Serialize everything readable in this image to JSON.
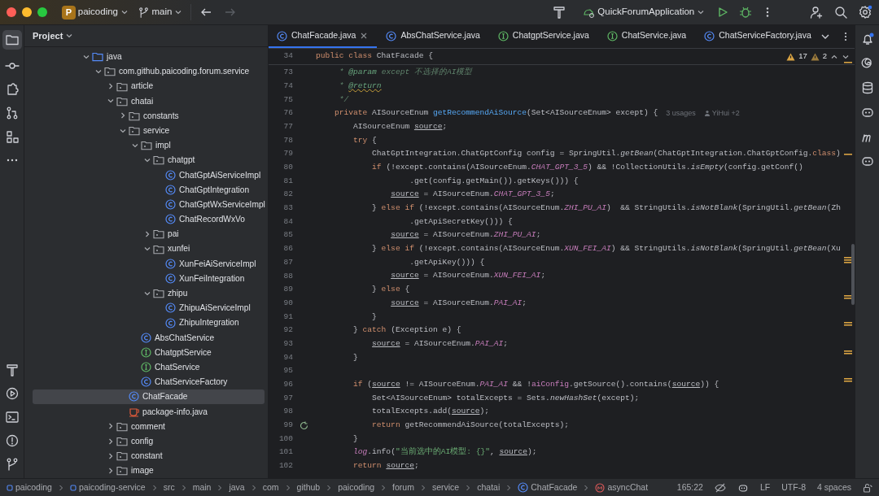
{
  "titlebar": {
    "project_badge": "P",
    "project": "paicoding",
    "branch": "main",
    "run_config": "QuickForumApplication"
  },
  "project_panel": {
    "title": "Project",
    "tree": [
      {
        "label": "java",
        "kind": "folder",
        "expanded": true,
        "selected": false,
        "children": [
          {
            "label": "com.github.paicoding.forum.service",
            "kind": "package",
            "expanded": true,
            "selected": false,
            "children": [
              {
                "label": "article",
                "kind": "package",
                "expanded": false,
                "selected": false
              },
              {
                "label": "chatai",
                "kind": "package",
                "expanded": true,
                "selected": false,
                "children": [
                  {
                    "label": "constants",
                    "kind": "package",
                    "expanded": false,
                    "selected": false
                  },
                  {
                    "label": "service",
                    "kind": "package",
                    "expanded": true,
                    "selected": false,
                    "children": [
                      {
                        "label": "impl",
                        "kind": "package",
                        "expanded": true,
                        "selected": false,
                        "children": [
                          {
                            "label": "chatgpt",
                            "kind": "package",
                            "expanded": true,
                            "selected": false,
                            "children": [
                              {
                                "label": "ChatGptAiServiceImpl",
                                "kind": "class",
                                "selected": false
                              },
                              {
                                "label": "ChatGptIntegration",
                                "kind": "class",
                                "selected": false
                              },
                              {
                                "label": "ChatGptWxServiceImpl",
                                "kind": "class",
                                "selected": false
                              },
                              {
                                "label": "ChatRecordWxVo",
                                "kind": "class",
                                "selected": false
                              }
                            ]
                          },
                          {
                            "label": "pai",
                            "kind": "package",
                            "expanded": false,
                            "selected": false
                          },
                          {
                            "label": "xunfei",
                            "kind": "package",
                            "expanded": true,
                            "selected": false,
                            "children": [
                              {
                                "label": "XunFeiAiServiceImpl",
                                "kind": "class",
                                "selected": false
                              },
                              {
                                "label": "XunFeiIntegration",
                                "kind": "class",
                                "selected": false
                              }
                            ]
                          },
                          {
                            "label": "zhipu",
                            "kind": "package",
                            "expanded": true,
                            "selected": false,
                            "children": [
                              {
                                "label": "ZhipuAiServiceImpl",
                                "kind": "class",
                                "selected": false
                              },
                              {
                                "label": "ZhipuIntegration",
                                "kind": "class",
                                "selected": false
                              }
                            ]
                          }
                        ]
                      },
                      {
                        "label": "AbsChatService",
                        "kind": "class",
                        "selected": false
                      },
                      {
                        "label": "ChatgptService",
                        "kind": "interface",
                        "selected": false
                      },
                      {
                        "label": "ChatService",
                        "kind": "interface",
                        "selected": false
                      },
                      {
                        "label": "ChatServiceFactory",
                        "kind": "class",
                        "selected": false
                      }
                    ]
                  },
                  {
                    "label": "ChatFacade",
                    "kind": "class",
                    "selected": true
                  },
                  {
                    "label": "package-info.java",
                    "kind": "file",
                    "selected": false
                  }
                ]
              },
              {
                "label": "comment",
                "kind": "package",
                "expanded": false,
                "selected": false
              },
              {
                "label": "config",
                "kind": "package",
                "expanded": false,
                "selected": false
              },
              {
                "label": "constant",
                "kind": "package",
                "expanded": false,
                "selected": false
              },
              {
                "label": "image",
                "kind": "package",
                "expanded": false,
                "selected": false
              }
            ]
          }
        ]
      }
    ]
  },
  "tabs": [
    {
      "label": "ChatFacade.java",
      "kind": "class",
      "selected": true
    },
    {
      "label": "AbsChatService.java",
      "kind": "class",
      "selected": false
    },
    {
      "label": "ChatgptService.java",
      "kind": "interface",
      "selected": false
    },
    {
      "label": "ChatService.java",
      "kind": "interface",
      "selected": false
    },
    {
      "label": "ChatServiceFactory.java",
      "kind": "class",
      "selected": false
    }
  ],
  "inspections": {
    "warnings": "17",
    "weak_warnings": "2"
  },
  "sticky_line": {
    "number": "34",
    "tokens": [
      {
        "text": "public class ",
        "kind": "keyword"
      },
      {
        "text": "ChatFacade {",
        "kind": "plain"
      }
    ]
  },
  "code_lines": [
    {
      "number": "73",
      "tokens": [
        {
          "text": "     * ",
          "kind": "comment"
        },
        {
          "text": "@param",
          "kind": "doctag"
        },
        {
          "text": " except 不选择的AI模型",
          "kind": "comment"
        }
      ]
    },
    {
      "number": "74",
      "tokens": [
        {
          "text": "     * ",
          "kind": "comment"
        },
        {
          "text": "@return",
          "kind": "doctag-warn"
        }
      ]
    },
    {
      "number": "75",
      "tokens": [
        {
          "text": "     */",
          "kind": "comment"
        }
      ]
    },
    {
      "number": "76",
      "tokens": [
        {
          "text": "    private ",
          "kind": "keyword"
        },
        {
          "text": "AISourceEnum ",
          "kind": "plain"
        },
        {
          "text": "getRecommendAiSource",
          "kind": "declaration"
        },
        {
          "text": "(Set<AISourceEnum> except) {",
          "kind": "plain"
        }
      ],
      "hints": [
        "3 usages",
        "YiHui +2"
      ]
    },
    {
      "number": "77",
      "tokens": [
        {
          "text": "        AISourceEnum ",
          "kind": "plain"
        },
        {
          "text": "source",
          "kind": "variable"
        },
        {
          "text": ";",
          "kind": "plain"
        }
      ]
    },
    {
      "number": "78",
      "tokens": [
        {
          "text": "        try",
          "kind": "keyword"
        },
        {
          "text": " {",
          "kind": "plain"
        }
      ]
    },
    {
      "number": "79",
      "tokens": [
        {
          "text": "            ChatGptIntegration.ChatGptConfig config = SpringUtil.",
          "kind": "plain"
        },
        {
          "text": "getBean",
          "kind": "static"
        },
        {
          "text": "(ChatGptIntegration.ChatGptConfig.",
          "kind": "plain"
        },
        {
          "text": "class",
          "kind": "keyword"
        },
        {
          "text": ")",
          "kind": "plain"
        }
      ]
    },
    {
      "number": "80",
      "tokens": [
        {
          "text": "            if",
          "kind": "keyword"
        },
        {
          "text": " (!except.contains(AISourceEnum.",
          "kind": "plain"
        },
        {
          "text": "CHAT_GPT_3_5",
          "kind": "constant"
        },
        {
          "text": ") && !CollectionUtils.",
          "kind": "plain"
        },
        {
          "text": "isEmpty",
          "kind": "static"
        },
        {
          "text": "(config.getConf()",
          "kind": "plain"
        }
      ]
    },
    {
      "number": "81",
      "tokens": [
        {
          "text": "                    .get(config.getMain()).getKeys())) {",
          "kind": "plain"
        }
      ]
    },
    {
      "number": "82",
      "tokens": [
        {
          "text": "                source",
          "kind": "variable"
        },
        {
          "text": " = AISourceEnum.",
          "kind": "plain"
        },
        {
          "text": "CHAT_GPT_3_5",
          "kind": "constant"
        },
        {
          "text": ";",
          "kind": "plain"
        }
      ]
    },
    {
      "number": "83",
      "tokens": [
        {
          "text": "            } ",
          "kind": "plain"
        },
        {
          "text": "else if",
          "kind": "keyword"
        },
        {
          "text": " (!except.contains(AISourceEnum.",
          "kind": "plain"
        },
        {
          "text": "ZHI_PU_AI",
          "kind": "constant"
        },
        {
          "text": ")  && StringUtils.",
          "kind": "plain"
        },
        {
          "text": "isNotBlank",
          "kind": "static"
        },
        {
          "text": "(SpringUtil.",
          "kind": "plain"
        },
        {
          "text": "getBean",
          "kind": "static"
        },
        {
          "text": "(Zh",
          "kind": "plain"
        }
      ]
    },
    {
      "number": "84",
      "tokens": [
        {
          "text": "                    .getApiSecretKey())) {",
          "kind": "plain"
        }
      ]
    },
    {
      "number": "85",
      "tokens": [
        {
          "text": "                source",
          "kind": "variable"
        },
        {
          "text": " = AISourceEnum.",
          "kind": "plain"
        },
        {
          "text": "ZHI_PU_AI",
          "kind": "constant"
        },
        {
          "text": ";",
          "kind": "plain"
        }
      ]
    },
    {
      "number": "86",
      "tokens": [
        {
          "text": "            } ",
          "kind": "plain"
        },
        {
          "text": "else if",
          "kind": "keyword"
        },
        {
          "text": " (!except.contains(AISourceEnum.",
          "kind": "plain"
        },
        {
          "text": "XUN_FEI_AI",
          "kind": "constant"
        },
        {
          "text": ") && StringUtils.",
          "kind": "plain"
        },
        {
          "text": "isNotBlank",
          "kind": "static"
        },
        {
          "text": "(SpringUtil.",
          "kind": "plain"
        },
        {
          "text": "getBean",
          "kind": "static"
        },
        {
          "text": "(Xu",
          "kind": "plain"
        }
      ]
    },
    {
      "number": "87",
      "tokens": [
        {
          "text": "                    .getApiKey())) {",
          "kind": "plain"
        }
      ]
    },
    {
      "number": "88",
      "tokens": [
        {
          "text": "                source",
          "kind": "variable"
        },
        {
          "text": " = AISourceEnum.",
          "kind": "plain"
        },
        {
          "text": "XUN_FEI_AI",
          "kind": "constant"
        },
        {
          "text": ";",
          "kind": "plain"
        }
      ]
    },
    {
      "number": "89",
      "tokens": [
        {
          "text": "            } ",
          "kind": "plain"
        },
        {
          "text": "else",
          "kind": "keyword"
        },
        {
          "text": " {",
          "kind": "plain"
        }
      ]
    },
    {
      "number": "90",
      "tokens": [
        {
          "text": "                source",
          "kind": "variable"
        },
        {
          "text": " = AISourceEnum.",
          "kind": "plain"
        },
        {
          "text": "PAI_AI",
          "kind": "constant"
        },
        {
          "text": ";",
          "kind": "plain"
        }
      ]
    },
    {
      "number": "91",
      "tokens": [
        {
          "text": "            }",
          "kind": "plain"
        }
      ]
    },
    {
      "number": "92",
      "tokens": [
        {
          "text": "        } ",
          "kind": "plain"
        },
        {
          "text": "catch",
          "kind": "keyword"
        },
        {
          "text": " (Exception e) {",
          "kind": "plain"
        }
      ]
    },
    {
      "number": "93",
      "tokens": [
        {
          "text": "            source",
          "kind": "variable"
        },
        {
          "text": " = AISourceEnum.",
          "kind": "plain"
        },
        {
          "text": "PAI_AI",
          "kind": "constant"
        },
        {
          "text": ";",
          "kind": "plain"
        }
      ]
    },
    {
      "number": "94",
      "tokens": [
        {
          "text": "        }",
          "kind": "plain"
        }
      ]
    },
    {
      "number": "95"
    },
    {
      "number": "96",
      "tokens": [
        {
          "text": "        if",
          "kind": "keyword"
        },
        {
          "text": " (",
          "kind": "plain"
        },
        {
          "text": "source",
          "kind": "variable"
        },
        {
          "text": " != AISourceEnum.",
          "kind": "plain"
        },
        {
          "text": "PAI_AI",
          "kind": "constant"
        },
        {
          "text": " && !",
          "kind": "plain"
        },
        {
          "text": "aiConfig",
          "kind": "field"
        },
        {
          "text": ".getSource().contains(",
          "kind": "plain"
        },
        {
          "text": "source",
          "kind": "variable"
        },
        {
          "text": ")) {",
          "kind": "plain"
        }
      ]
    },
    {
      "number": "97",
      "tokens": [
        {
          "text": "            Set<AISourceEnum> totalExcepts = Sets.",
          "kind": "plain"
        },
        {
          "text": "newHashSet",
          "kind": "static"
        },
        {
          "text": "(except);",
          "kind": "plain"
        }
      ]
    },
    {
      "number": "98",
      "tokens": [
        {
          "text": "            totalExcepts.add(",
          "kind": "plain"
        },
        {
          "text": "source",
          "kind": "variable"
        },
        {
          "text": ");",
          "kind": "plain"
        }
      ]
    },
    {
      "number": "99",
      "recursive": true,
      "tokens": [
        {
          "text": "            return",
          "kind": "keyword"
        },
        {
          "text": " getRecommendAiSource(totalExcepts);",
          "kind": "plain"
        }
      ]
    },
    {
      "number": "100",
      "tokens": [
        {
          "text": "        }",
          "kind": "plain"
        }
      ]
    },
    {
      "number": "101",
      "tokens": [
        {
          "text": "        log",
          "kind": "static-field"
        },
        {
          "text": ".info(",
          "kind": "plain"
        },
        {
          "text": "\"当前选中的AI模型: {}\"",
          "kind": "string"
        },
        {
          "text": ", ",
          "kind": "plain"
        },
        {
          "text": "source",
          "kind": "variable"
        },
        {
          "text": ");",
          "kind": "plain"
        }
      ]
    },
    {
      "number": "102",
      "tokens": [
        {
          "text": "        return",
          "kind": "keyword"
        },
        {
          "text": " source",
          "kind": "variable"
        },
        {
          "text": ";",
          "kind": "plain"
        }
      ]
    }
  ],
  "status_bar": {
    "breadcrumbs": [
      {
        "text": "paicoding",
        "kind": "module"
      },
      {
        "text": "paicoding-service",
        "kind": "module"
      },
      {
        "text": "src",
        "kind": "dir"
      },
      {
        "text": "main",
        "kind": "dir"
      },
      {
        "text": "java",
        "kind": "dir"
      },
      {
        "text": "com",
        "kind": "dir"
      },
      {
        "text": "github",
        "kind": "dir"
      },
      {
        "text": "paicoding",
        "kind": "dir"
      },
      {
        "text": "forum",
        "kind": "dir"
      },
      {
        "text": "service",
        "kind": "dir"
      },
      {
        "text": "chatai",
        "kind": "dir"
      },
      {
        "text": "ChatFacade",
        "kind": "class"
      },
      {
        "text": "asyncChat",
        "kind": "method"
      }
    ],
    "position": "165:22",
    "line_separator": "LF",
    "encoding": "UTF-8",
    "indent": "4 spaces"
  }
}
